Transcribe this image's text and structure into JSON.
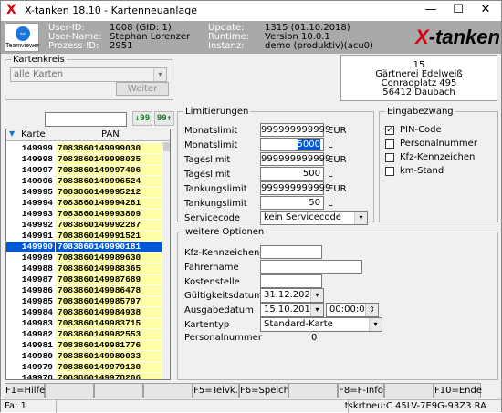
{
  "window": {
    "title": "X-tanken 18.10 - Kartenneuanlage",
    "minimize": "—",
    "maximize": "☐",
    "close": "✕"
  },
  "teamviewer": {
    "label": "Teamviewer"
  },
  "header": {
    "user_id_label": "User-ID:",
    "user_id": "1008 (GID: 1)",
    "user_name_label": "User-Name:",
    "user_name": "Stephan Lorenzer",
    "process_id_label": "Prozess-ID:",
    "process_id": "2951",
    "update_label": "Update:",
    "update": "1315 (01.10.2018)",
    "runtime_label": "Runtime:",
    "runtime": "Version 10.0.1",
    "instance_label": "Instanz:",
    "instance": "demo (produktiv)(acu0)",
    "brand_x": "X",
    "brand_rest": "-tanken"
  },
  "kartenkreis": {
    "legend": "Kartenkreis",
    "value": "alle Karten",
    "button": "Weiter"
  },
  "address": {
    "line1": "15",
    "line2": "Gärtnerei Edelweiß",
    "line3": "Conradplatz 495",
    "line4": "56412 Daubach"
  },
  "grid": {
    "col_karte": "Karte",
    "col_pan": "PAN",
    "btn_down": "↓99",
    "btn_up": "99↑",
    "rows": [
      {
        "karte": "149999",
        "pan": "7083860149999030"
      },
      {
        "karte": "149998",
        "pan": "7083860149998035"
      },
      {
        "karte": "149997",
        "pan": "7083860149997406"
      },
      {
        "karte": "149996",
        "pan": "7083860149996524"
      },
      {
        "karte": "149995",
        "pan": "7083860149995212"
      },
      {
        "karte": "149994",
        "pan": "7083860149994281"
      },
      {
        "karte": "149993",
        "pan": "7083860149993809"
      },
      {
        "karte": "149992",
        "pan": "7083860149992287"
      },
      {
        "karte": "149991",
        "pan": "7083860149991521"
      },
      {
        "karte": "149990",
        "pan": "7083860149990181",
        "selected": true
      },
      {
        "karte": "149989",
        "pan": "7083860149989630"
      },
      {
        "karte": "149988",
        "pan": "7083860149988365"
      },
      {
        "karte": "149987",
        "pan": "7083860149987689"
      },
      {
        "karte": "149986",
        "pan": "7083860149986478"
      },
      {
        "karte": "149985",
        "pan": "7083860149985797"
      },
      {
        "karte": "149984",
        "pan": "7083860149984938"
      },
      {
        "karte": "149983",
        "pan": "7083860149983715"
      },
      {
        "karte": "149982",
        "pan": "7083860149982553"
      },
      {
        "karte": "149981",
        "pan": "7083860149981776"
      },
      {
        "karte": "149980",
        "pan": "7083860149980033"
      },
      {
        "karte": "149979",
        "pan": "7083860149979130"
      },
      {
        "karte": "149978",
        "pan": "7083860149978206"
      }
    ]
  },
  "limits": {
    "legend": "Limitierungen",
    "monat_label": "Monatslimit",
    "monat_eur": "999999999999",
    "monat_eur_unit": "EUR",
    "monat_l_label": "Monatslimit",
    "monat_l": "5000",
    "monat_l_unit": "L",
    "tag_label": "Tageslimit",
    "tag_eur": "999999999999",
    "tag_eur_unit": "EUR",
    "tag_l_label": "Tageslimit",
    "tag_l": "500",
    "tag_l_unit": "L",
    "tank_label": "Tankungslimit",
    "tank_eur": "999999999999",
    "tank_eur_unit": "EUR",
    "tank_l_label": "Tankungslimit",
    "tank_l": "50",
    "tank_l_unit": "L",
    "service_label": "Servicecode",
    "service": "kein Servicecode"
  },
  "eingabezwang": {
    "legend": "Eingabezwang",
    "items": [
      {
        "label": "PIN-Code",
        "checked": true
      },
      {
        "label": "Personalnummer",
        "checked": false
      },
      {
        "label": "Kfz-Kennzeichen",
        "checked": false
      },
      {
        "label": "km-Stand",
        "checked": false
      }
    ]
  },
  "options": {
    "legend": "weitere Optionen",
    "kfz_label": "Kfz-Kennzeichen",
    "kfz": "",
    "fahrer_label": "Fahrername",
    "fahrer": "",
    "kosten_label": "Kostenstelle",
    "kosten": "",
    "gueltig_label": "Gültigkeitsdatum",
    "gueltig": "31.12.2029",
    "ausgabe_label": "Ausgabedatum",
    "ausgabe": "15.10.2018",
    "ausgabe_zeit": "00:00:00",
    "typ_label": "Kartentyp",
    "typ": "Standard-Karte",
    "personal_label": "Personalnummer",
    "personal": "0"
  },
  "fkeys": {
    "f1": "F1=Hilfe",
    "f5": "F5=Telvk.",
    "f6": "F6=Speich.",
    "f8": "F8=F-Info",
    "f10": "F10=Ende"
  },
  "status": {
    "left": "Fa: 1",
    "right": "tskrtneu:C 45LV-7E9G-93Z3 RA"
  }
}
